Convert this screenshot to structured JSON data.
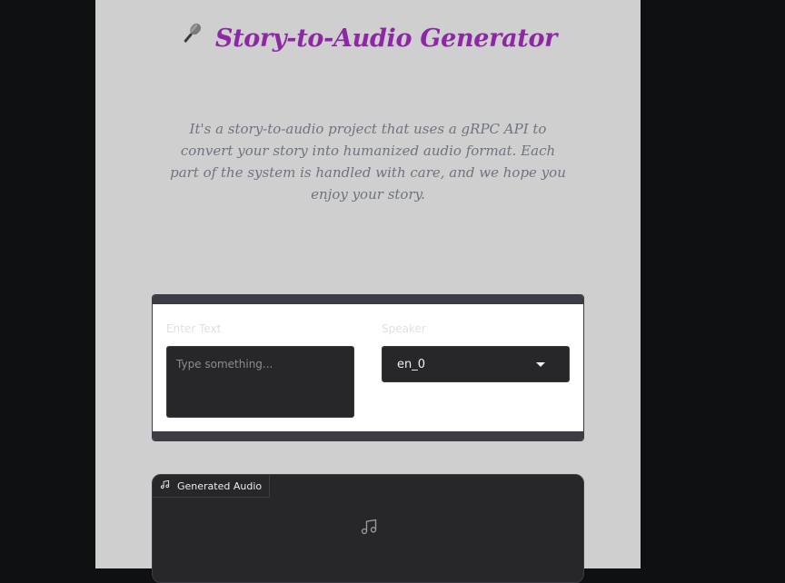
{
  "header": {
    "title": "Story-to-Audio Generator",
    "icon": "microphone-icon"
  },
  "description": "It's a story-to-audio project that uses a gRPC API to convert your story into humanized audio format. Each part of the system is handled with care, and we hope you enjoy your story.",
  "form": {
    "text_label": "Enter Text",
    "text_placeholder": "Type something...",
    "text_value": "",
    "speaker_label": "Speaker",
    "speaker_value": "en_0"
  },
  "audio": {
    "label": "Generated Audio",
    "icon": "music-note-icon"
  },
  "colors": {
    "background": "#0f1012",
    "page": "#cfcfcf",
    "title": "#8e27a6",
    "description": "#6e7480",
    "input_bg": "#27272a"
  }
}
